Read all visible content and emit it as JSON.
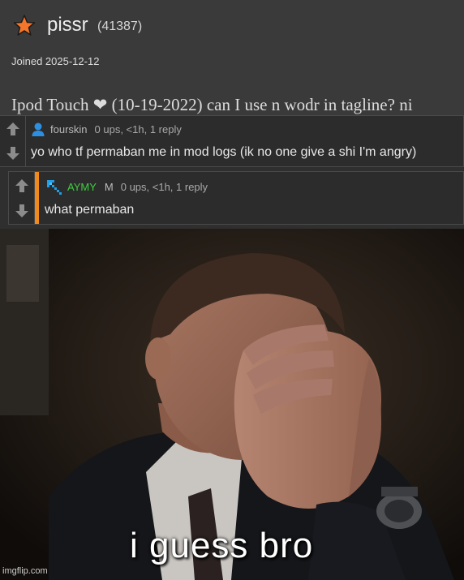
{
  "profile": {
    "username": "pissr",
    "user_id": "(41387)",
    "joined": "Joined 2025-12-12",
    "tagline": "Ipod Touch ❤ (10-19-2022) can I use n wodr in tagline? ni",
    "rank_icon": "star-icon",
    "rank_color": "#f4762a"
  },
  "comments": [
    {
      "author": "fourskin",
      "author_icon": "person-icon",
      "stats": "0 ups, <1h, 1 reply",
      "text": "yo who tf permaban me in mod logs (ik no one give a shi I'm angry)"
    },
    {
      "author": "AYMY",
      "author_color": "#3fcf3f",
      "author_icon": "pickaxe-icon",
      "badge": "M",
      "stats": "0 ups, <1h, 1 reply",
      "text": "what permaban",
      "accent": "#f08a1c"
    }
  ],
  "meme": {
    "caption": "i guess bro",
    "watermark": "imgflip.com"
  }
}
